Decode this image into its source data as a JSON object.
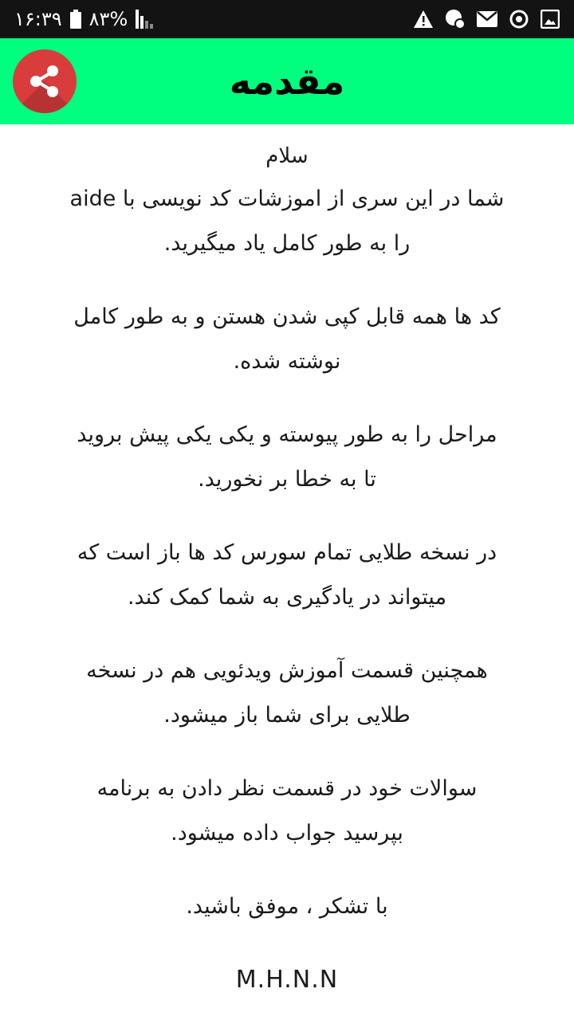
{
  "status_bar": {
    "time": "۱۶:۳۹",
    "battery": "۸۳%",
    "icons": [
      "battery-icon",
      "signal-icon",
      "warning-icon",
      "game-notification-icon",
      "mail-icon",
      "sync-icon",
      "image-icon"
    ]
  },
  "app_bar": {
    "title": "مقدمه",
    "background": "#00ff7f",
    "share_icon": "share-icon",
    "share_color": "#d83c3c"
  },
  "content": {
    "greeting": "سلام",
    "paragraphs": [
      "شما در این سری از اموزشات کد نویسی با aide\nرا به طور کامل یاد میگیرید.",
      "کد ها همه قابل کپی شدن هستن و به طور کامل\nنوشته شده.",
      "مراحل را به طور پیوسته و یکی یکی پیش بروید\nتا به خطا بر نخورید.",
      "در نسخه طلایی تمام سورس کد ها باز است که\nمیتواند در یادگیری به شما کمک کند.",
      "همچنین قسمت آموزش ویدئویی هم در نسخه\nطلایی برای شما باز میشود.",
      "سوالات خود در قسمت نظر دادن به برنامه\nبپرسید جواب داده میشود.",
      "با تشکر ، موفق باشید."
    ],
    "signature": "M.H.N.N"
  }
}
